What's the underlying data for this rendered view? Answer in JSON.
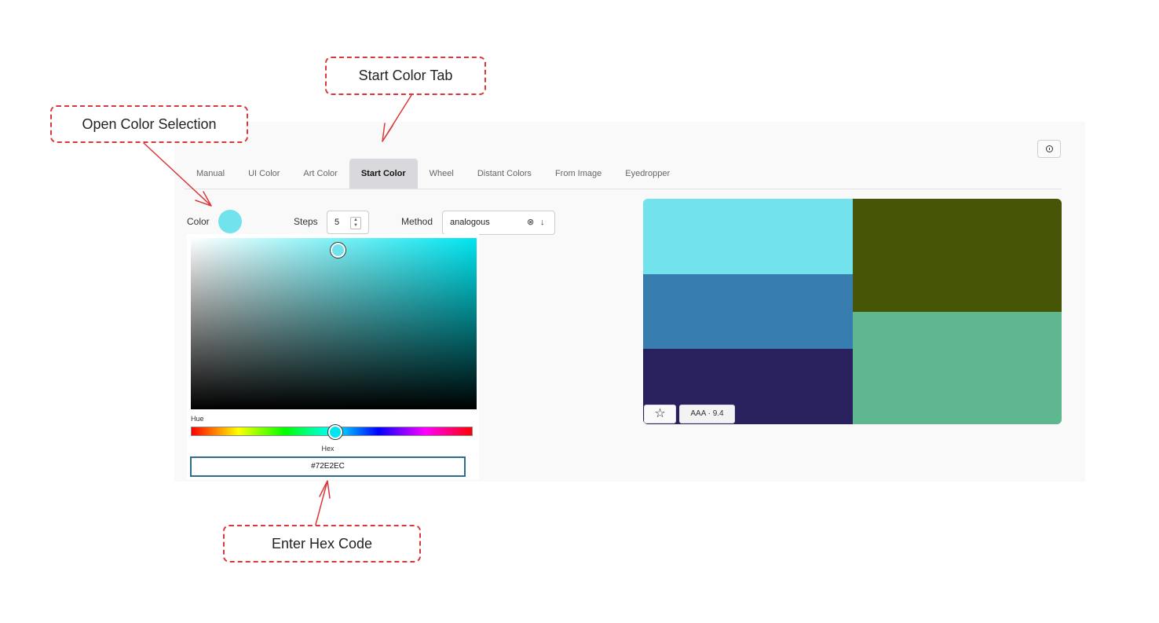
{
  "tabs": [
    {
      "label": "Manual",
      "active": false
    },
    {
      "label": "UI Color",
      "active": false
    },
    {
      "label": "Art Color",
      "active": false
    },
    {
      "label": "Start Color",
      "active": true
    },
    {
      "label": "Wheel",
      "active": false
    },
    {
      "label": "Distant Colors",
      "active": false
    },
    {
      "label": "From Image",
      "active": false
    },
    {
      "label": "Eyedropper",
      "active": false
    }
  ],
  "controls": {
    "color_label": "Color",
    "color_value": "#72E2EC",
    "steps_label": "Steps",
    "steps_value": "5",
    "method_label": "Method",
    "method_value": "analogous"
  },
  "picker": {
    "hue_label": "Hue",
    "hex_label": "Hex",
    "hex_value": "#72E2EC",
    "hue_color": "#00E5F0"
  },
  "palette": {
    "columns": [
      [
        "#72E2EC",
        "#387DB0",
        "#29215E"
      ],
      [
        "#465606",
        "#5EB78F"
      ]
    ],
    "contrast_label": "AAA · 9.4",
    "star_icon": "star-outline-icon"
  },
  "annotations": {
    "start_color_tab": "Start Color Tab",
    "open_color_selection": "Open Color Selection",
    "enter_hex_code": "Enter Hex Code"
  },
  "colors": {
    "annotation_red": "#D9383A"
  }
}
